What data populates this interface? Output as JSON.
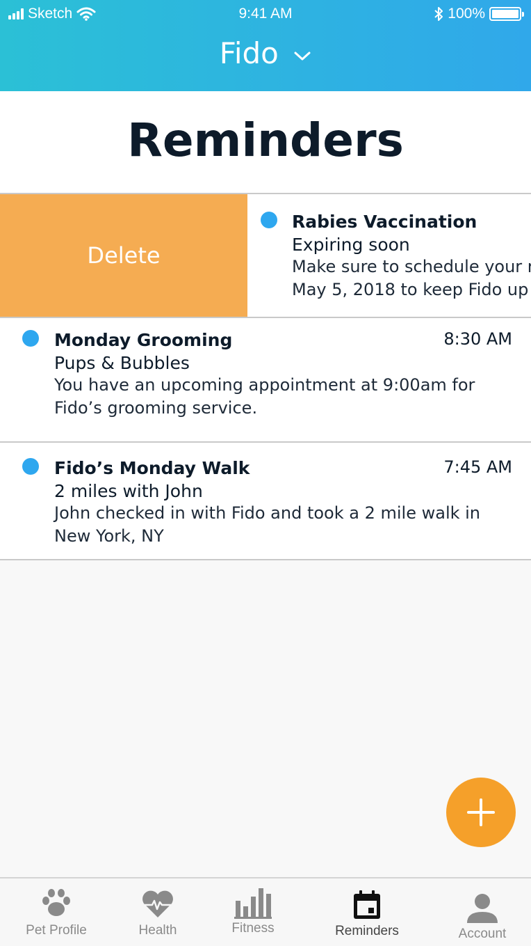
{
  "status_bar": {
    "carrier": "Sketch",
    "time": "9:41 AM",
    "battery": "100%"
  },
  "header": {
    "pet_name": "Fido"
  },
  "page": {
    "title": "Reminders"
  },
  "swiped_row": {
    "delete_label": "Delete",
    "title": "Rabies Vaccination",
    "subtitle": "Expiring soon",
    "body_line1": "Make sure to schedule your r",
    "body_line2": "May 5, 2018 to keep Fido up"
  },
  "reminders": [
    {
      "title": "Monday Grooming",
      "subtitle": "Pups & Bubbles",
      "body_line1": "You have an upcoming appointment at 9:00am for",
      "body_line2": "Fido’s grooming service.",
      "time": "8:30 AM"
    },
    {
      "title": "Fido’s Monday Walk",
      "subtitle": "2 miles with John",
      "body_line1": "John checked in with Fido and took a 2 mile walk in",
      "body_line2": "New York, NY",
      "time": "7:45 AM"
    }
  ],
  "tabs": [
    {
      "label": "Pet Profile",
      "icon": "paw-icon"
    },
    {
      "label": "Health",
      "icon": "heart-pulse-icon"
    },
    {
      "label": "Fitness",
      "icon": "bar-chart-icon"
    },
    {
      "label": "Reminders",
      "icon": "calendar-icon",
      "active": true
    },
    {
      "label": "Account",
      "icon": "person-icon"
    }
  ],
  "colors": {
    "header_gradient_start": "#2bc0d6",
    "header_gradient_end": "#30a8ea",
    "accent_blue": "#2ea7ef",
    "delete_orange": "#f5ac52",
    "fab_orange": "#f5a02a"
  }
}
